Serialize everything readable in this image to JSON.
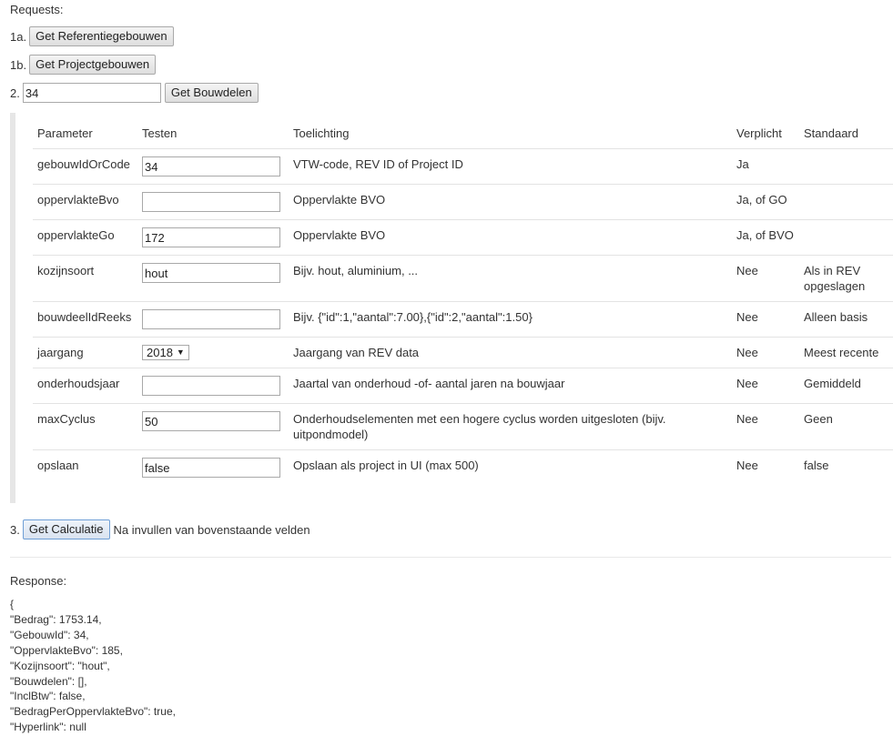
{
  "requests_heading": "Requests:",
  "req1a": {
    "num": "1a.",
    "button": "Get Referentiegebouwen"
  },
  "req1b": {
    "num": "1b.",
    "button": "Get Projectgebouwen"
  },
  "req2": {
    "num": "2.",
    "input_value": "34",
    "button": "Get Bouwdelen"
  },
  "table": {
    "headers": [
      "Parameter",
      "Testen",
      "Toelichting",
      "Verplicht",
      "Standaard"
    ],
    "rows": [
      {
        "param": "gebouwIdOrCode",
        "value": "34",
        "toelichting": "VTW-code, REV ID of Project ID",
        "verplicht": "Ja",
        "standaard": ""
      },
      {
        "param": "oppervlakteBvo",
        "value": "",
        "toelichting": "Oppervlakte BVO",
        "verplicht": "Ja, of GO",
        "standaard": ""
      },
      {
        "param": "oppervlakteGo",
        "value": "172",
        "toelichting": "Oppervlakte BVO",
        "verplicht": "Ja, of BVO",
        "standaard": ""
      },
      {
        "param": "kozijnsoort",
        "value": "hout",
        "toelichting": "Bijv. hout, aluminium, ...",
        "verplicht": "Nee",
        "standaard": "Als in REV opgeslagen"
      },
      {
        "param": "bouwdeelIdReeks",
        "value": "",
        "toelichting": "Bijv. {\"id\":1,\"aantal\":7.00},{\"id\":2,\"aantal\":1.50}",
        "verplicht": "Nee",
        "standaard": "Alleen basis"
      },
      {
        "param": "jaargang",
        "value": "2018",
        "toelichting": "Jaargang van REV data",
        "verplicht": "Nee",
        "standaard": "Meest recente"
      },
      {
        "param": "onderhoudsjaar",
        "value": "",
        "toelichting": "Jaartal van onderhoud -of- aantal jaren na bouwjaar",
        "verplicht": "Nee",
        "standaard": "Gemiddeld"
      },
      {
        "param": "maxCyclus",
        "value": "50",
        "toelichting": "Onderhoudselementen met een hogere cyclus worden uitgesloten (bijv. uitpondmodel)",
        "verplicht": "Nee",
        "standaard": "Geen"
      },
      {
        "param": "opslaan",
        "value": "false",
        "toelichting": "Opslaan als project in UI (max 500)",
        "verplicht": "Nee",
        "standaard": "false"
      }
    ]
  },
  "req3": {
    "num": "3.",
    "button": "Get Calculatie",
    "note": "Na invullen van bovenstaande velden"
  },
  "response_label": "Response:",
  "response_lines": [
    "{",
    "\"Bedrag\": 1753.14,",
    "\"GebouwId\": 34,",
    "\"OppervlakteBvo\": 185,",
    "\"Kozijnsoort\": \"hout\",",
    "\"Bouwdelen\": [],",
    "\"InclBtw\": false,",
    "\"BedragPerOppervlakteBvo\": true,",
    "\"Hyperlink\": null"
  ]
}
